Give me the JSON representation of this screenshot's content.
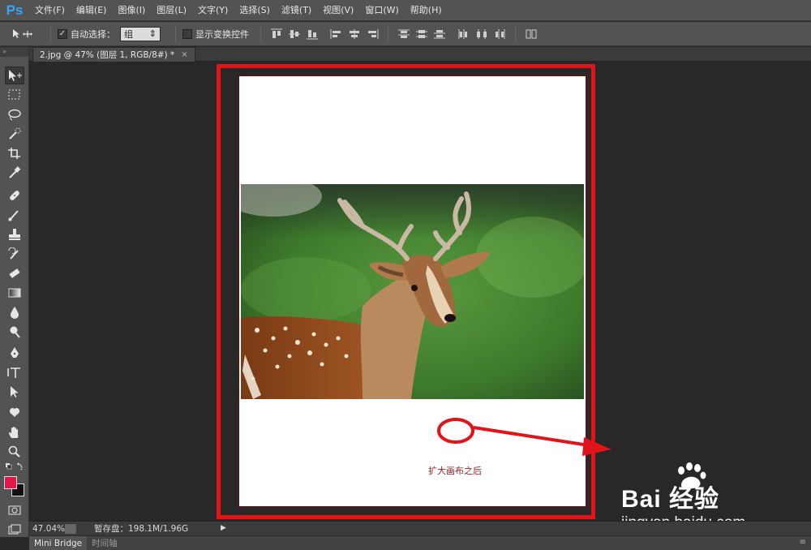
{
  "app": {
    "logo": "Ps",
    "menu": [
      "文件(F)",
      "编辑(E)",
      "图像(I)",
      "图层(L)",
      "文字(Y)",
      "选择(S)",
      "滤镜(T)",
      "视图(V)",
      "窗口(W)",
      "帮助(H)"
    ]
  },
  "options": {
    "auto_select_label": "自动选择：",
    "auto_select_checked": true,
    "auto_select_value": "组",
    "show_transform_label": "显示变换控件",
    "show_transform_checked": false
  },
  "document": {
    "tab_title": "2.jpg @ 47% (图层 1, RGB/8#) *",
    "close_glyph": "×",
    "annotation_text": "扩大画布之后"
  },
  "status": {
    "zoom": "47.04%",
    "scratch": "暂存盘：198.1M/1.96G"
  },
  "bottom_tabs": [
    "Mini Bridge",
    "时间轴"
  ],
  "watermark": {
    "brand": "Bai  经验",
    "url": "jingyan.baidu.com"
  },
  "colors": {
    "foreground": "#e0194a",
    "background": "#111111",
    "annotation_red": "#e1141a"
  }
}
